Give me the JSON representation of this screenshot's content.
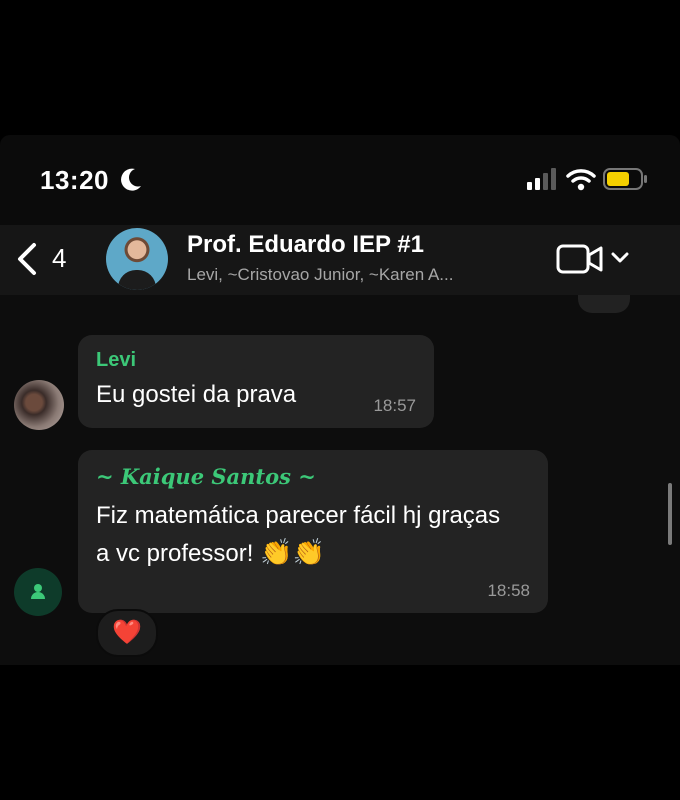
{
  "status_bar": {
    "time": "13:20"
  },
  "header": {
    "back_count": "4",
    "title": "Prof. Eduardo IEP #1",
    "subtitle": "Levi, ~Cristovao Junior, ~Karen A..."
  },
  "messages": [
    {
      "sender": "Levi",
      "text": "Eu gostei da prava",
      "time": "18:57"
    },
    {
      "sender": "~ Kaique Santos ~",
      "text": "Fiz matemática parecer fácil hj graças a vc professor!",
      "emoji": "👏👏",
      "time": "18:58",
      "reaction": "❤️"
    }
  ],
  "colors": {
    "sender_name": "#3cc878",
    "bubble": "#232323",
    "header_bg": "#161616",
    "battery": "#f5d000"
  }
}
